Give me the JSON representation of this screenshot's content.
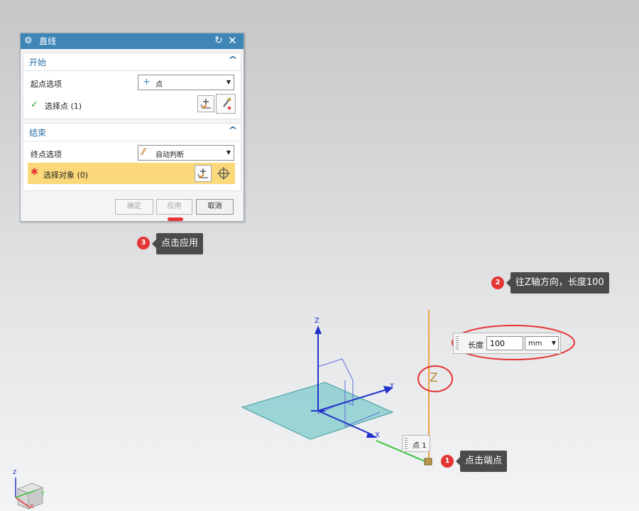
{
  "dialog": {
    "title": "直线",
    "icons": {
      "title": "gear-icon",
      "reset": "reset-icon",
      "close": "close-icon"
    },
    "start_section": {
      "header": "开始",
      "option_label": "起点选项",
      "option_value": "点",
      "select_label": "选择点 (1)"
    },
    "end_section": {
      "header": "结束",
      "option_label": "终点选项",
      "option_value": "自动判断",
      "select_label": "选择对象 (0)"
    },
    "buttons": {
      "ok": "确定",
      "apply": "应用",
      "cancel": "取消"
    }
  },
  "callouts": [
    {
      "number": "1",
      "text": "点击端点"
    },
    {
      "number": "2",
      "text": "往Z轴方向，长度100"
    },
    {
      "number": "3",
      "text": "点击应用"
    }
  ],
  "length_input": {
    "label": "长度",
    "value": "100",
    "unit": "mm"
  },
  "viewport": {
    "point_label": "点 1",
    "z_axis_marker": "Z",
    "axis_labels": {
      "z": "Z",
      "y": "Y",
      "x": "X"
    },
    "triad_labels": {
      "z": "Z",
      "y": "Y",
      "x": "X"
    }
  },
  "colors": {
    "titlebar": "#3f86b6",
    "highlight": "#fbd97a",
    "callout_bg": "#4b4b4b",
    "badge": "#e53434",
    "annotation_ellipse": "#e53434",
    "line_preview": "#f0a040",
    "plane_fill": "#8ccfd0"
  }
}
